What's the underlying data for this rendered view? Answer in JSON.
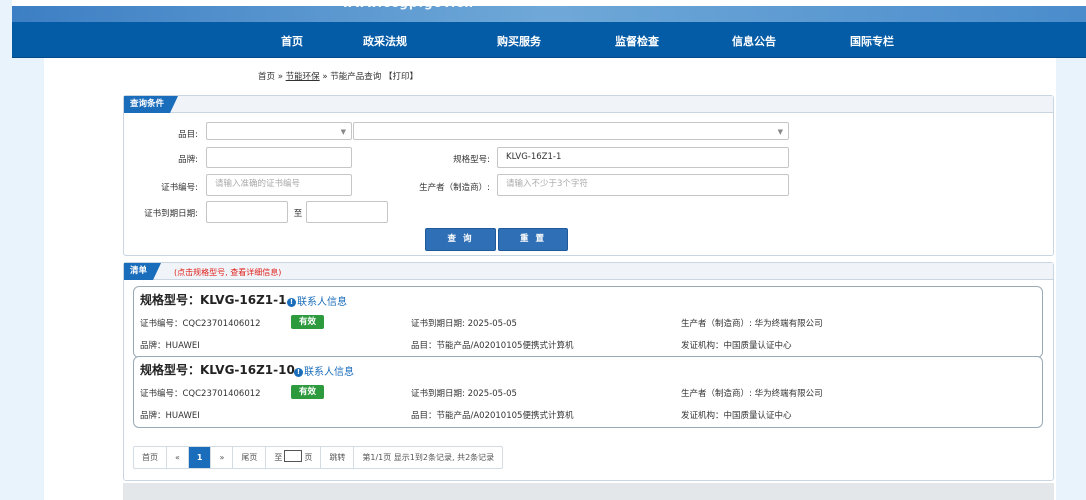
{
  "header": {
    "site_url": "www.ccgp.gov.cn",
    "nav": [
      "首页",
      "政采法规",
      "购买服务",
      "监督检查",
      "信息公告",
      "国际专栏"
    ]
  },
  "breadcrumb": {
    "home": "首页",
    "sep1": "»",
    "section": "节能环保",
    "sep2": "»",
    "page": "节能产品查询",
    "print": "【打印】"
  },
  "query": {
    "title": "查询条件",
    "category_label": "品目:",
    "brand_label": "品牌:",
    "brand_value": "",
    "model_label": "规格型号:",
    "model_value": "KLVG-16Z1-1",
    "cert_label": "证书编号:",
    "cert_placeholder": "请输入准确的证书编号",
    "maker_label": "生产者（制造商）:",
    "maker_placeholder": "请输入不少于3个字符",
    "expiry_label": "证书到期日期:",
    "to_label": "至",
    "search_btn": "查 询",
    "reset_btn": "重 置"
  },
  "list": {
    "title": "清单",
    "note": "(点击规格型号, 查看详细信息)",
    "contact_label": "联系人信息",
    "items": [
      {
        "title": "规格型号：KLVG-16Z1-1",
        "cert": "证书编号：CQC23701406012",
        "status": "有效",
        "expiry": "证书到期日期: 2025-05-05",
        "maker": "生产者（制造商）: 华为终端有限公司",
        "brand": "品牌：HUAWEI",
        "category": "品目：节能产品/A02010105便携式计算机",
        "issuer": "发证机构：中国质量认证中心"
      },
      {
        "title": "规格型号：KLVG-16Z1-10",
        "cert": "证书编号：CQC23701406012",
        "status": "有效",
        "expiry": "证书到期日期: 2025-05-05",
        "maker": "生产者（制造商）: 华为终端有限公司",
        "brand": "品牌：HUAWEI",
        "category": "品目：节能产品/A02010105便携式计算机",
        "issuer": "发证机构：中国质量认证中心"
      }
    ]
  },
  "pager": {
    "first": "首页",
    "prev": "«",
    "current": "1",
    "next": "»",
    "last": "尾页",
    "goto_prefix": "至",
    "goto_suffix": "页",
    "jump": "跳转",
    "info": "第1/1页 显示1到2条记录, 共2条记录"
  },
  "colors": {
    "nav": "#045ba6",
    "accent": "#1a6dbb",
    "valid": "#2e9a3e",
    "note": "#e0201b"
  }
}
